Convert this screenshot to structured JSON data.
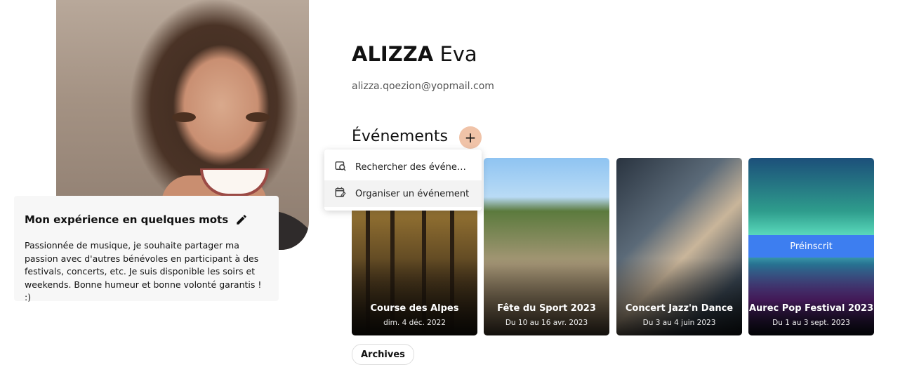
{
  "profile": {
    "last_name": "ALIZZA",
    "first_name": "Eva",
    "email": "alizza.qoezion@yopmail.com"
  },
  "about": {
    "title": "Mon expérience en quelques mots",
    "text": "Passionnée de musique, je souhaite partager ma passion avec d'autres bénévoles en participant à des festivals, concerts, etc. Je suis disponible les soirs et weekends. Bonne humeur et bonne volonté garantis ! :)"
  },
  "events": {
    "title": "Événements",
    "add_label": "+",
    "menu": [
      {
        "label": "Rechercher des événemen...",
        "icon": "search-calendar-icon"
      },
      {
        "label": "Organiser un événement",
        "icon": "edit-calendar-icon"
      }
    ],
    "cards": [
      {
        "title": "Course des Alpes",
        "date": "dim. 4 déc. 2022"
      },
      {
        "title": "Fête du Sport 2023",
        "date": "Du 10 au 16 avr. 2023"
      },
      {
        "title": "Concert Jazz'n Dance",
        "date": "Du 3 au 4 juin 2023"
      },
      {
        "title": "Aurec Pop Festival 2023",
        "date": "Du 1 au 3 sept. 2023",
        "badge": "Préinscrit"
      }
    ],
    "archives_label": "Archives"
  },
  "colors": {
    "add_button": "#f0c3a8",
    "badge": "#3d7ef0"
  }
}
